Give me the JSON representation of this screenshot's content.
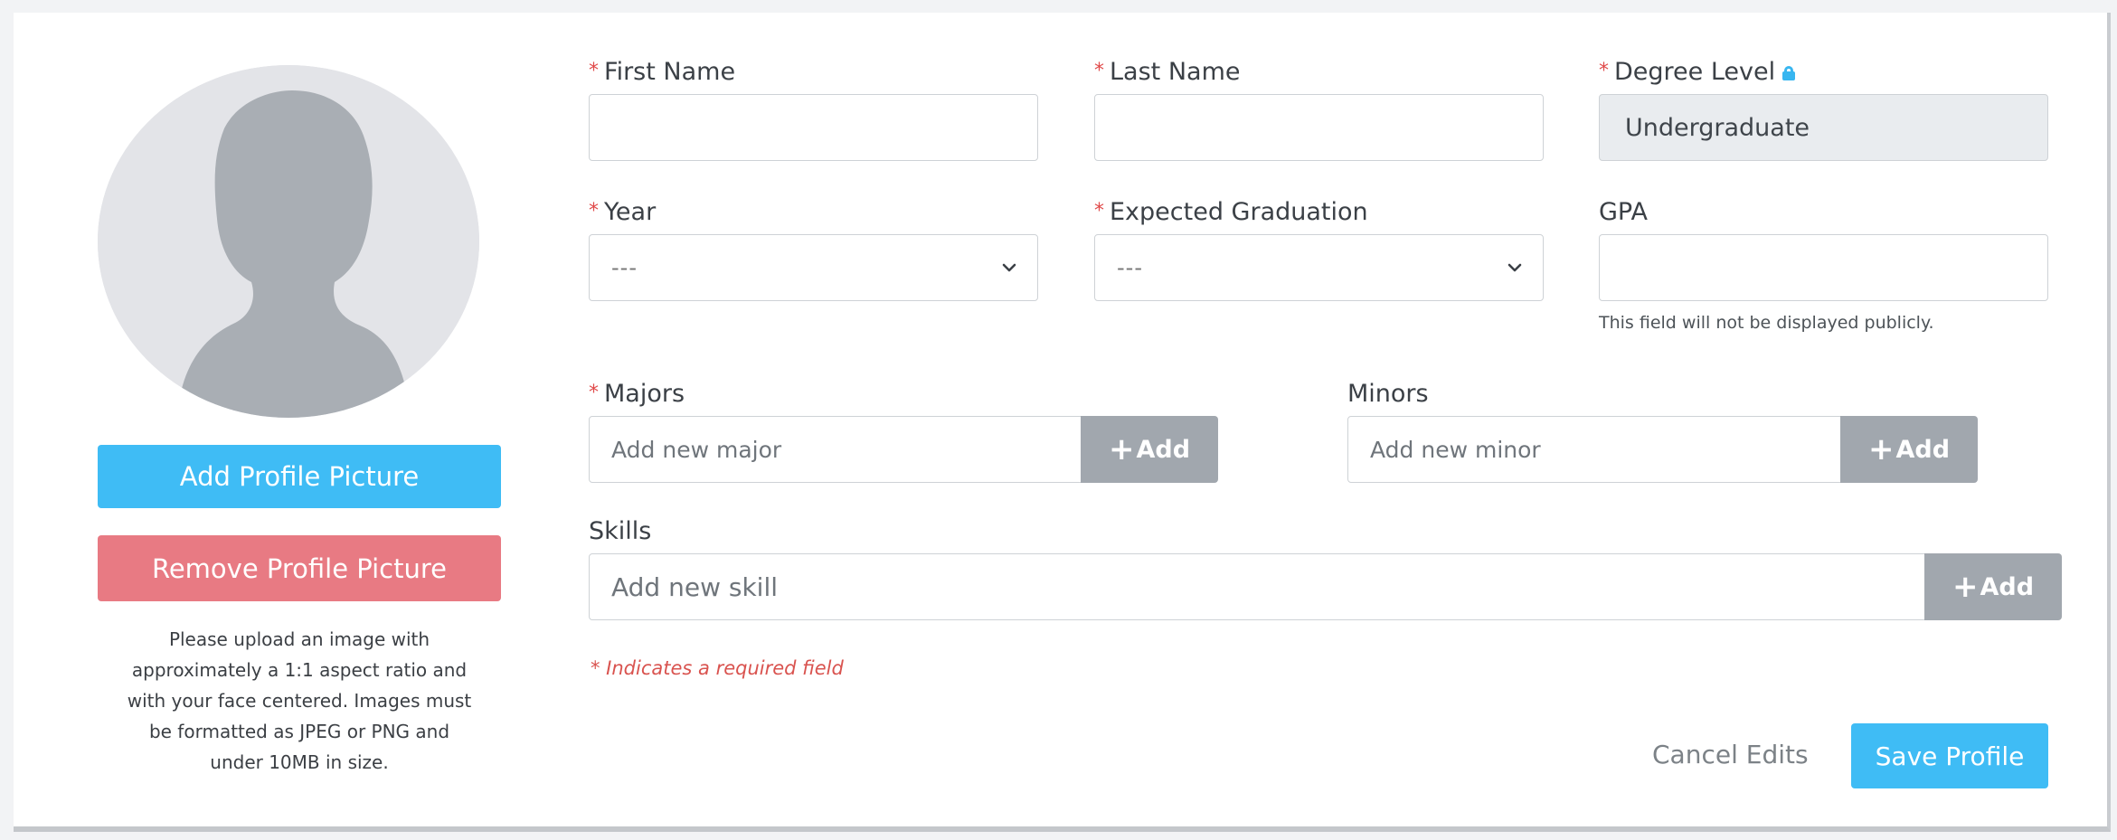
{
  "profile_picture": {
    "add_label": "Add Profile Picture",
    "remove_label": "Remove Profile Picture",
    "note": "Please upload an image with approximately a 1:1 aspect ratio and with your face centered. Images must be formatted as JPEG or PNG and under 10MB in size.",
    "note_lines": [
      "Please upload an image with",
      "approximately a 1:1 aspect ratio and",
      "with your face centered. Images must",
      "be formatted as JPEG or PNG and",
      "under 10MB in size."
    ]
  },
  "form": {
    "required_marker": "*",
    "first_name": {
      "label": "First Name",
      "value": ""
    },
    "last_name": {
      "label": "Last Name",
      "value": ""
    },
    "degree_level": {
      "label": "Degree Level",
      "value": "Undergraduate",
      "icon": "lock-icon"
    },
    "year": {
      "label": "Year",
      "selected": "---"
    },
    "expected_graduation": {
      "label": "Expected Graduation",
      "selected": "---"
    },
    "gpa": {
      "label": "GPA",
      "value": "",
      "help": "This field will not be displayed publicly."
    },
    "majors": {
      "label": "Majors",
      "placeholder": "Add new major",
      "add_label": "Add",
      "add_icon": "plus-icon"
    },
    "minors": {
      "label": "Minors",
      "placeholder": "Add new minor",
      "add_label": "Add",
      "add_icon": "plus-icon"
    },
    "skills": {
      "label": "Skills",
      "placeholder": "Add new skill",
      "add_label": "Add",
      "add_icon": "plus-icon"
    },
    "required_note": "* Indicates a required field"
  },
  "actions": {
    "cancel_label": "Cancel Edits",
    "save_label": "Save Profile"
  },
  "colors": {
    "primary": "#3fbcf5",
    "danger": "#e87a83",
    "required": "#e04a4a",
    "add_button": "#a1a7ae",
    "disabled_field": "#e9ecef"
  }
}
